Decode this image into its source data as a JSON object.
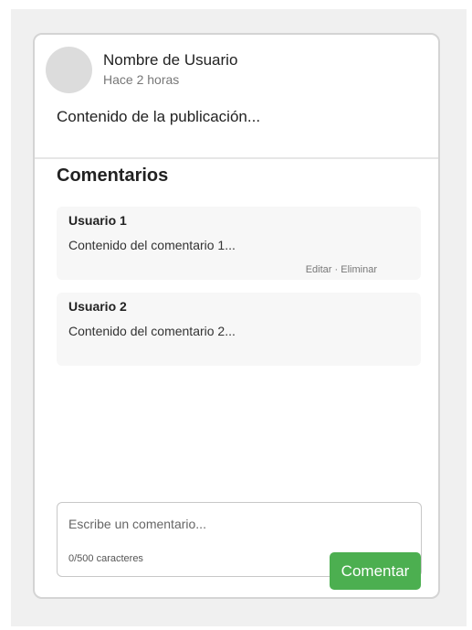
{
  "post": {
    "author": "Nombre de Usuario",
    "timestamp": "Hace 2 horas",
    "content": "Contenido de la publicación..."
  },
  "comments_section": {
    "title": "Comentarios",
    "comments": [
      {
        "author": "Usuario 1",
        "text": "Contenido del comentario 1...",
        "edit_label": "Editar",
        "separator": "·",
        "delete_label": "Eliminar"
      },
      {
        "author": "Usuario 2",
        "text": "Contenido del comentario 2..."
      }
    ]
  },
  "composer": {
    "placeholder": "Escribe un comentario...",
    "char_count": "0/500 caracteres",
    "submit_label": "Comentar"
  },
  "colors": {
    "accent": "#4caf50",
    "background": "#f0f0f0",
    "avatar_placeholder": "#dcdcdc"
  }
}
